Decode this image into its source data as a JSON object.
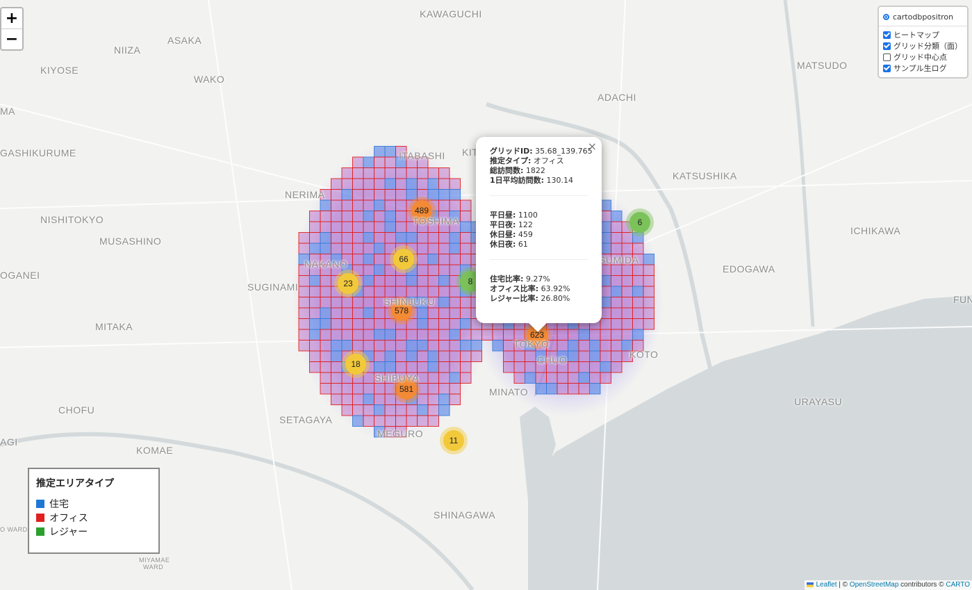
{
  "map": {
    "labels": [
      {
        "text": "KAWAGUCHI"
      },
      {
        "text": "NIIZA"
      },
      {
        "text": "ASAKA"
      },
      {
        "text": "KIYOSE"
      },
      {
        "text": "WAKO"
      },
      {
        "text": "MA"
      },
      {
        "text": "MATSUDO"
      },
      {
        "text": "ADACHI"
      },
      {
        "text": "GASHIKURUME"
      },
      {
        "text": "ITABASHI"
      },
      {
        "text": "KITA"
      },
      {
        "text": "KATSUSHIKA"
      },
      {
        "text": "NERIMA"
      },
      {
        "text": "NISHITOKYO"
      },
      {
        "text": "TOSHIMA"
      },
      {
        "text": "ICHIKAWA"
      },
      {
        "text": "MUSASHINO"
      },
      {
        "text": "SUMIDA"
      },
      {
        "text": "NAKANO"
      },
      {
        "text": "EDOGAWA"
      },
      {
        "text": "OGANEI"
      },
      {
        "text": "SUGINAMI"
      },
      {
        "text": "SHINJUKU"
      },
      {
        "text": "FUN"
      },
      {
        "text": "MITAKA"
      },
      {
        "text": "TOKYO"
      },
      {
        "text": "CHUO"
      },
      {
        "text": "KOTO"
      },
      {
        "text": "SHIBUYA"
      },
      {
        "text": "URAYASU"
      },
      {
        "text": "CHOFU"
      },
      {
        "text": "MINATO"
      },
      {
        "text": "SETAGAYA"
      },
      {
        "text": "MEGURO"
      },
      {
        "text": "AGI"
      },
      {
        "text": "KOMAE"
      },
      {
        "text": "SHINAGAWA"
      },
      {
        "text": "O WARD"
      },
      {
        "text": "MIYAMAE"
      },
      {
        "text": "WARD"
      }
    ],
    "clusters": [
      {
        "count": "489",
        "color": "#f28a36"
      },
      {
        "count": "66",
        "color": "#f2c93a"
      },
      {
        "count": "23",
        "color": "#f2c93a"
      },
      {
        "count": "578",
        "color": "#f28a36"
      },
      {
        "count": "8",
        "color": "#7cc25a"
      },
      {
        "count": "18",
        "color": "#f2c93a"
      },
      {
        "count": "581",
        "color": "#f28a36"
      },
      {
        "count": "11",
        "color": "#f2c93a"
      },
      {
        "count": "623",
        "color": "#f28a36"
      },
      {
        "count": "6",
        "color": "#7cc25a"
      }
    ]
  },
  "zoom": {
    "in_label": "+",
    "out_label": "−"
  },
  "layers": {
    "base": "cartodbpositron",
    "overlays": [
      {
        "label": "ヒートマップ",
        "checked": true
      },
      {
        "label": "グリッド分類（面）",
        "checked": true
      },
      {
        "label": "グリッド中心点",
        "checked": false
      },
      {
        "label": "サンプル生ログ",
        "checked": true
      }
    ]
  },
  "legend": {
    "title": "推定エリアタイプ",
    "items": [
      {
        "label": "住宅",
        "color": "#1f77d4"
      },
      {
        "label": "オフィス",
        "color": "#e02020"
      },
      {
        "label": "レジャー",
        "color": "#2ca02c"
      }
    ]
  },
  "popup": {
    "close": "×",
    "lines1": [
      {
        "k": "グリッドID:",
        "v": " 35.68_139.765"
      },
      {
        "k": "推定タイプ:",
        "v": " オフィス"
      },
      {
        "k": "総訪問数:",
        "v": " 1822"
      },
      {
        "k": "1日平均訪問数:",
        "v": " 130.14"
      }
    ],
    "lines2": [
      {
        "k": "平日昼:",
        "v": " 1100"
      },
      {
        "k": "平日夜:",
        "v": " 122"
      },
      {
        "k": "休日昼:",
        "v": " 459"
      },
      {
        "k": "休日夜:",
        "v": " 61"
      }
    ],
    "lines3": [
      {
        "k": "住宅比率:",
        "v": " 9.27%"
      },
      {
        "k": "オフィス比率:",
        "v": " 63.92%"
      },
      {
        "k": "レジャー比率:",
        "v": " 26.80%"
      }
    ]
  },
  "attribution": {
    "leaflet": "Leaflet",
    "sep": " | © ",
    "osm": "OpenStreetMap",
    "mid": " contributors © ",
    "carto": "CARTO"
  }
}
